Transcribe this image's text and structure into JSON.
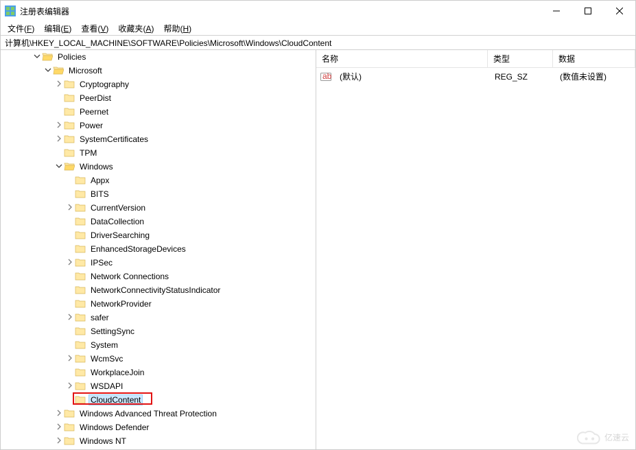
{
  "window": {
    "title": "注册表编辑器"
  },
  "menu": {
    "file": {
      "label": "文件",
      "ak": "F"
    },
    "edit": {
      "label": "编辑",
      "ak": "E"
    },
    "view": {
      "label": "查看",
      "ak": "V"
    },
    "fav": {
      "label": "收藏夹",
      "ak": "A"
    },
    "help": {
      "label": "帮助",
      "ak": "H"
    }
  },
  "address": "计算机\\HKEY_LOCAL_MACHINE\\SOFTWARE\\Policies\\Microsoft\\Windows\\CloudContent",
  "list": {
    "headers": {
      "name": "名称",
      "type": "类型",
      "data": "数据"
    },
    "row0": {
      "name": "(默认)",
      "type": "REG_SZ",
      "data": "(数值未设置)"
    }
  },
  "tree": {
    "policies": "Policies",
    "microsoft": "Microsoft",
    "cryptography": "Cryptography",
    "peerdist": "PeerDist",
    "peernet": "Peernet",
    "power": "Power",
    "systemcertificates": "SystemCertificates",
    "tpm": "TPM",
    "windows": "Windows",
    "appx": "Appx",
    "bits": "BITS",
    "currentversion": "CurrentVersion",
    "datacollection": "DataCollection",
    "driversearching": "DriverSearching",
    "enhancedstoragedevices": "EnhancedStorageDevices",
    "ipsec": "IPSec",
    "networkconnections": "Network Connections",
    "networkconnectivitystatusindicator": "NetworkConnectivityStatusIndicator",
    "networkprovider": "NetworkProvider",
    "safer": "safer",
    "settingsync": "SettingSync",
    "system": "System",
    "wcmsvc": "WcmSvc",
    "workplacejoin": "WorkplaceJoin",
    "wsdapi": "WSDAPI",
    "cloudcontent": "CloudContent",
    "watp": "Windows Advanced Threat Protection",
    "windowsdefender": "Windows Defender",
    "windowsnt": "Windows NT"
  },
  "watermark": "亿速云"
}
